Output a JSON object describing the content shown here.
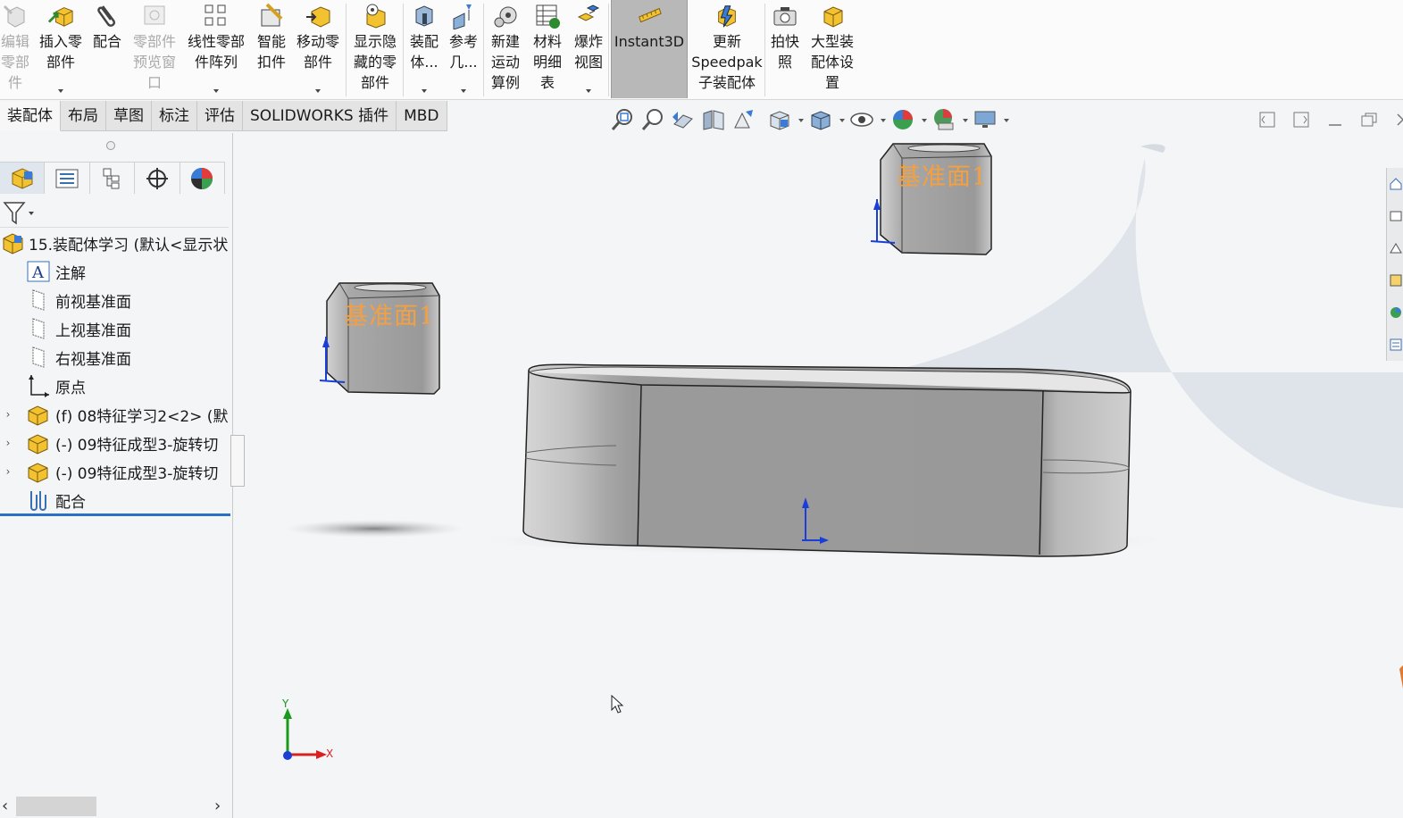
{
  "ribbon": {
    "buttons": [
      {
        "id": "edit-component",
        "label": "编辑\n零部\n件",
        "icon": "edit-component-icon",
        "disabled": true
      },
      {
        "id": "insert-components",
        "label": "插入零\n部件",
        "icon": "insert-components-icon",
        "dropdown": true
      },
      {
        "id": "mate",
        "label": "配合",
        "icon": "paperclip-mate-icon"
      },
      {
        "id": "component-preview",
        "label": "零部件\n预览窗\n口",
        "icon": "preview-window-icon",
        "disabled": true
      },
      {
        "id": "linear-pattern",
        "label": "线性零部\n件阵列",
        "icon": "linear-pattern-icon",
        "dropdown": true
      },
      {
        "id": "smart-fasteners",
        "label": "智能\n扣件",
        "icon": "smart-fasteners-icon"
      },
      {
        "id": "move-component",
        "label": "移动零\n部件",
        "icon": "move-component-icon",
        "dropdown": true
      },
      {
        "id": "show-hidden",
        "label": "显示隐\n藏的零\n部件",
        "icon": "show-hidden-icon"
      },
      {
        "id": "assembly-features",
        "label": "装配\n体...",
        "icon": "assembly-features-icon",
        "dropdown": true
      },
      {
        "id": "reference-geometry",
        "label": "参考\n几...",
        "icon": "reference-geometry-icon",
        "dropdown": true
      },
      {
        "id": "new-motion-study",
        "label": "新建\n运动\n算例",
        "icon": "motion-study-icon"
      },
      {
        "id": "bill-of-materials",
        "label": "材料\n明细\n表",
        "icon": "bom-table-icon"
      },
      {
        "id": "exploded-view",
        "label": "爆炸\n视图",
        "icon": "exploded-view-icon",
        "dropdown": true
      },
      {
        "id": "instant3d",
        "label": "Instant3D",
        "icon": "instant3d-icon",
        "active": true
      },
      {
        "id": "update-speedpak",
        "label": "更新\nSpeedpak\n子装配体",
        "icon": "speedpak-icon"
      },
      {
        "id": "snapshot",
        "label": "拍快\n照",
        "icon": "camera-icon"
      },
      {
        "id": "large-assembly",
        "label": "大型装\n配体设\n置",
        "icon": "large-assembly-icon"
      }
    ]
  },
  "tabs": [
    "装配体",
    "布局",
    "草图",
    "标注",
    "评估",
    "SOLIDWORKS 插件",
    "MBD"
  ],
  "active_tab": "装配体",
  "view_toolbar": {
    "icons": [
      "zoom-to-fit-icon",
      "zoom-to-area-icon",
      "previous-view-icon",
      "section-view-icon",
      "dynamic-annotation-icon",
      "view-orientation-icon",
      "display-style-icon",
      "hide-show-items-icon",
      "edit-appearance-icon",
      "apply-scene-icon",
      "view-settings-icon"
    ]
  },
  "feature_tree": {
    "root": "15.装配体学习 (默认<显示状",
    "items": [
      {
        "label": "注解",
        "icon": "annotations-icon"
      },
      {
        "label": "前视基准面",
        "icon": "plane-icon"
      },
      {
        "label": "上视基准面",
        "icon": "plane-icon"
      },
      {
        "label": "右视基准面",
        "icon": "plane-icon"
      },
      {
        "label": "原点",
        "icon": "origin-icon"
      },
      {
        "label": "(f) 08特征学习2<2> (默",
        "icon": "part-icon",
        "expandable": true
      },
      {
        "label": "(-) 09特征成型3-旋转切",
        "icon": "part-icon",
        "expandable": true
      },
      {
        "label": "(-) 09特征成型3-旋转切",
        "icon": "part-icon",
        "expandable": true
      },
      {
        "label": "配合",
        "icon": "mates-icon"
      }
    ]
  },
  "viewport": {
    "plane_labels": [
      "基准面1",
      "基准面1"
    ],
    "triad": {
      "x": "X",
      "y": "Y"
    }
  },
  "colors": {
    "accent": "#2a6fc7",
    "plane_label": "#f5a040",
    "part_gray": "#9a9a9a",
    "background": "#f3f5f7"
  }
}
